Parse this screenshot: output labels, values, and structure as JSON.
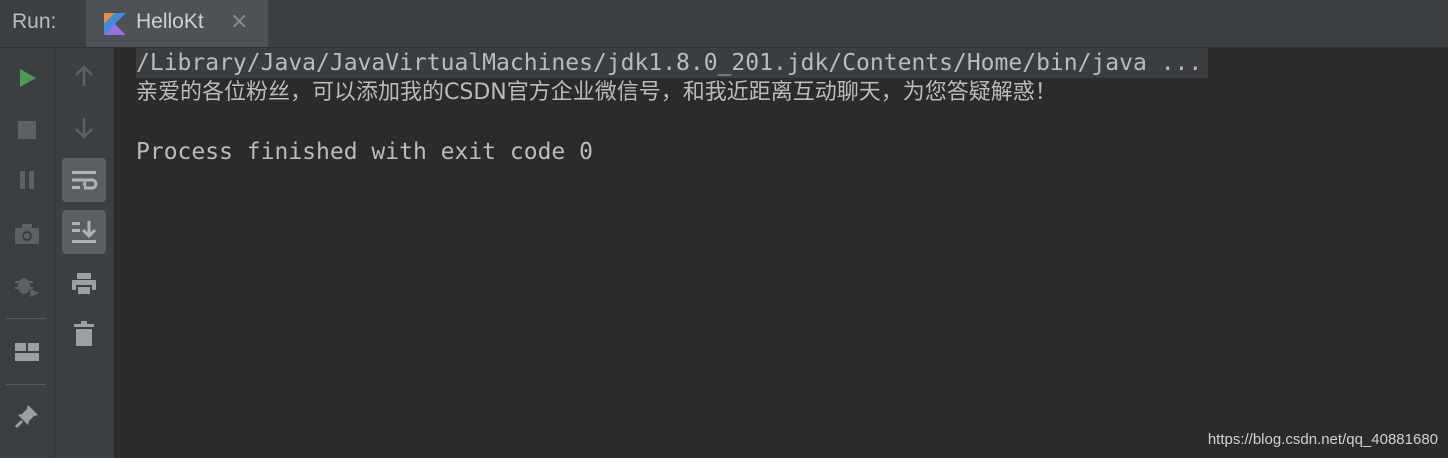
{
  "header": {
    "run_label": "Run:",
    "tab": {
      "label": "HelloKt",
      "close": "×",
      "icon": "kotlin-icon"
    }
  },
  "toolbar_left": [
    "run-icon",
    "stop-icon",
    "pause-icon",
    "camera-icon",
    "debug-restart-icon",
    "layout-icon",
    "pin-icon"
  ],
  "toolbar_right": [
    "arrow-up-icon",
    "arrow-down-icon",
    "soft-wrap-icon",
    "scroll-to-end-icon",
    "print-icon",
    "trash-icon"
  ],
  "console": {
    "command": "/Library/Java/JavaVirtualMachines/jdk1.8.0_201.jdk/Contents/Home/bin/java ...",
    "message": "亲爱的各位粉丝，可以添加我的CSDN官方企业微信号，和我近距离互动聊天，为您答疑解惑！",
    "exit": "Process finished with exit code 0"
  },
  "watermark": "https://blog.csdn.net/qq_40881680",
  "colors": {
    "background": "#2b2b2b",
    "toolbar": "#3c3f41",
    "run_green": "#499c54",
    "text": "#bbbbbb",
    "kotlin_orange": "#f08b3a",
    "kotlin_blue": "#3c8ddb"
  }
}
